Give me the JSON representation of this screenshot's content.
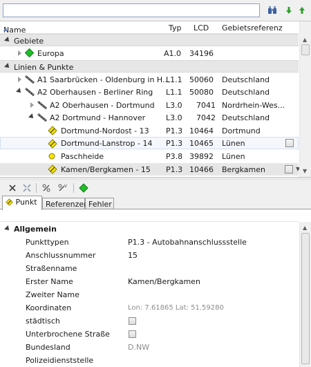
{
  "colors": {
    "accent": "#3a7bd5",
    "green": "#1fbf2a",
    "yellow": "#f7e400",
    "group_bg": "#e6e6e6"
  },
  "search": {
    "value": ""
  },
  "search_buttons": [
    {
      "icon": "binoculars-icon"
    },
    {
      "icon": "arrow-down-icon"
    },
    {
      "icon": "arrow-up-icon"
    }
  ],
  "table": {
    "columns": {
      "name": "Name",
      "typ": "Typ",
      "lcd": "LCD",
      "gebietsreferenz": "Gebietsreferenz"
    },
    "groups": [
      "Gebiete",
      "Linien & Punkte"
    ],
    "rows": [
      {
        "name": "Europa",
        "typ": "A1.0",
        "lcd": "34196",
        "ref": ""
      },
      {
        "name": "A1 Saarbrücken - Oldenburg in H...",
        "typ": "L1.1",
        "lcd": "50060",
        "ref": "Deutschland"
      },
      {
        "name": "A2 Oberhausen - Berliner Ring",
        "typ": "L1.1",
        "lcd": "50080",
        "ref": "Deutschland"
      },
      {
        "name": "A2 Oberhausen - Dortmund",
        "typ": "L3.0",
        "lcd": "7041",
        "ref": "Nordrhein-Wes..."
      },
      {
        "name": "A2 Dortmund - Hannover",
        "typ": "L3.0",
        "lcd": "7042",
        "ref": "Deutschland"
      },
      {
        "name": "Dortmund-Nordost - 13",
        "typ": "P1.3",
        "lcd": "10464",
        "ref": "Dortmund"
      },
      {
        "name": "Dortmund-Lanstrop - 14",
        "typ": "P1.3",
        "lcd": "10465",
        "ref": "Lünen"
      },
      {
        "name": "Paschheide",
        "typ": "P3.8",
        "lcd": "39892",
        "ref": "Lünen"
      },
      {
        "name": "Kamen/Bergkamen - 15",
        "typ": "P1.3",
        "lcd": "10466",
        "ref": "Bergkamen"
      }
    ]
  },
  "toolbar": {
    "icons": [
      "close-icon",
      "disconnect-icon",
      "link-icon",
      "link-v-icon",
      "green-diamond-icon"
    ]
  },
  "tabs": [
    "Punkt",
    "Referenzen",
    "Fehler"
  ],
  "properties": {
    "category": "Allgemein",
    "items": [
      {
        "label": "Punkttypen",
        "value": "P1.3 - Autobahnanschlussstelle"
      },
      {
        "label": "Anschlussnummer",
        "value": "15"
      },
      {
        "label": "Straßenname",
        "value": ""
      },
      {
        "label": "Erster Name",
        "value": "Kamen/Bergkamen"
      },
      {
        "label": "Zweiter Name",
        "value": ""
      },
      {
        "label": "Koordinaten",
        "value": "Lon: 7.61865  Lat: 51.59280"
      },
      {
        "label": "städtisch",
        "value": ""
      },
      {
        "label": "Unterbrochene Straße",
        "value": ""
      },
      {
        "label": "Bundesland",
        "value": "D.NW"
      },
      {
        "label": "Polizeidienststelle",
        "value": ""
      }
    ]
  }
}
